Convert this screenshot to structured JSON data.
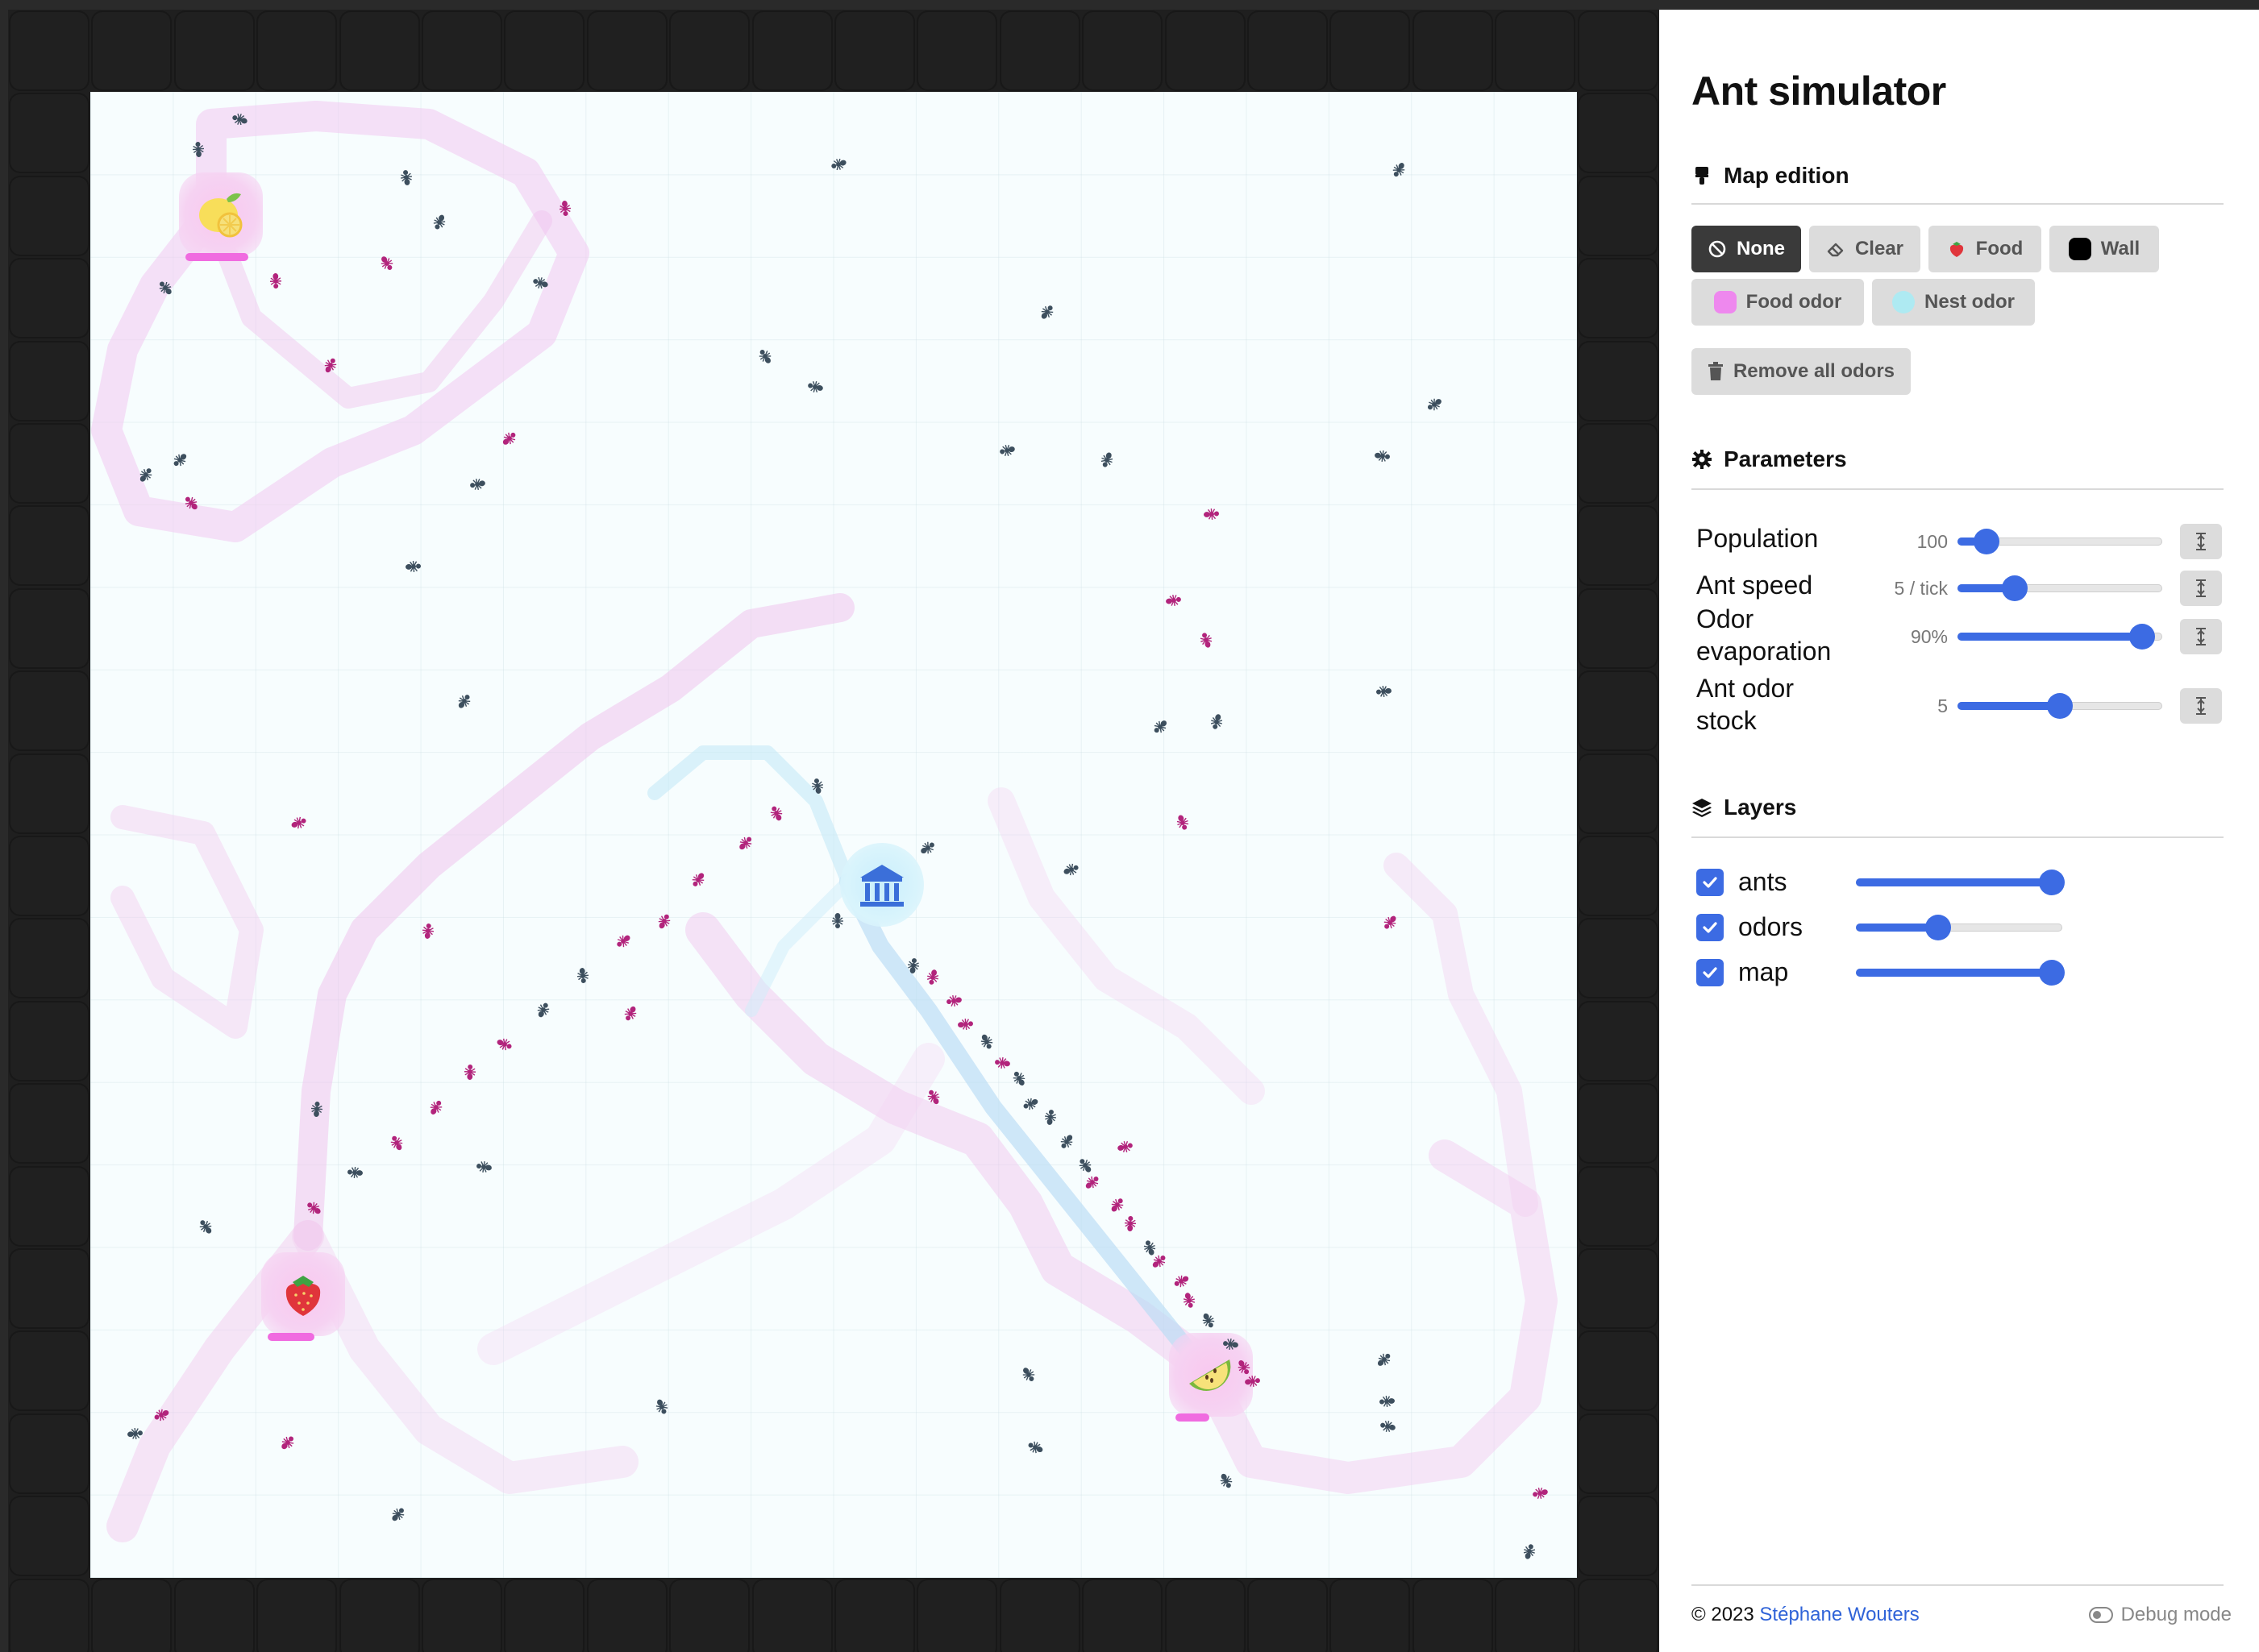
{
  "sidebar": {
    "title": "Ant simulator",
    "map_edition": {
      "title": "Map edition",
      "tools": [
        {
          "label": "None",
          "icon": "ban-icon",
          "active": true
        },
        {
          "label": "Clear",
          "icon": "eraser-icon",
          "active": false
        },
        {
          "label": "Food",
          "icon": "strawberry-icon",
          "active": false
        },
        {
          "label": "Wall",
          "swatch": "#000000",
          "active": false
        },
        {
          "label": "Food odor",
          "swatch": "#ee88ee",
          "active": false
        },
        {
          "label": "Nest odor",
          "swatch": "#aeeaf2",
          "active": false
        }
      ],
      "remove_all": "Remove all odors"
    },
    "parameters": {
      "title": "Parameters",
      "items": [
        {
          "label": "Population",
          "value": "100",
          "level": 0.14
        },
        {
          "label": "Ant speed",
          "value": "5 / tick",
          "level": 0.28
        },
        {
          "label": "Odor evaporation",
          "value": "90%",
          "level": 0.9
        },
        {
          "label": "Ant odor stock",
          "value": "5",
          "level": 0.5
        }
      ]
    },
    "layers": {
      "title": "Layers",
      "items": [
        {
          "label": "ants",
          "checked": true,
          "level": 0.95
        },
        {
          "label": "odors",
          "checked": true,
          "level": 0.4
        },
        {
          "label": "map",
          "checked": true,
          "level": 0.95
        }
      ]
    },
    "footer": {
      "copyright": "© 2023",
      "author": "Stéphane Wouters",
      "debug_label": "Debug mode"
    }
  },
  "colors": {
    "accent": "#3c6be3",
    "wall": "#202020",
    "food_odor": "#ee88ee",
    "nest_odor": "#aeeaf2",
    "ant_with_food": "#b2247c",
    "ant_searching": "#3d4f5e"
  },
  "map": {
    "food_sources": [
      {
        "name": "lemon",
        "icon": "lemon-icon"
      },
      {
        "name": "strawberry",
        "icon": "strawberry-icon"
      },
      {
        "name": "melon",
        "icon": "melon-icon"
      }
    ],
    "nest": {
      "icon": "nest-icon"
    }
  }
}
